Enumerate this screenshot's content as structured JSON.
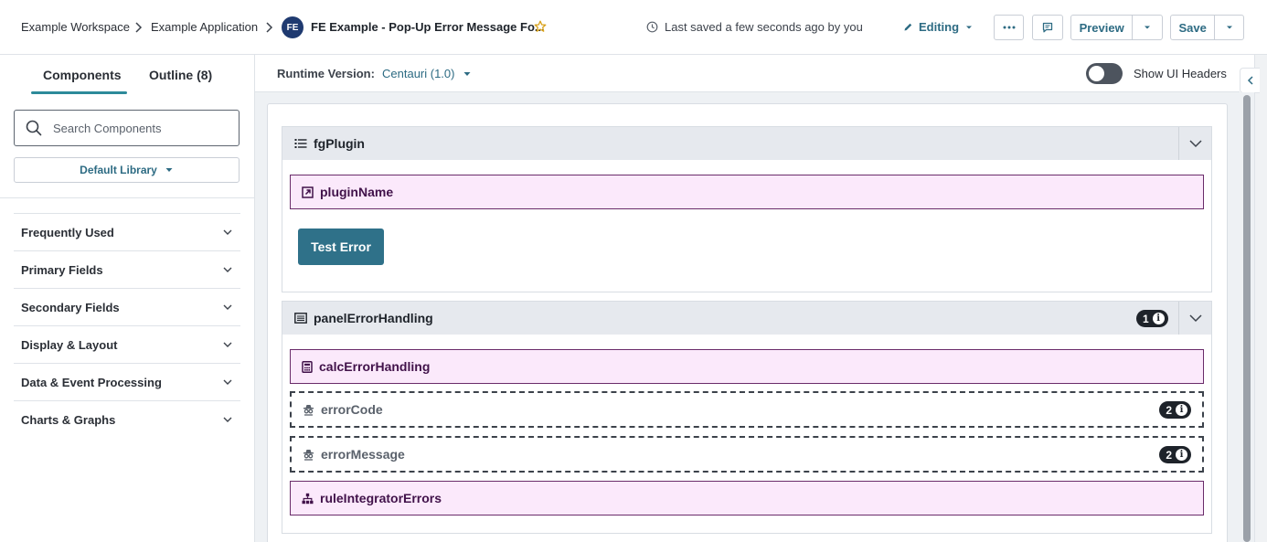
{
  "breadcrumb": {
    "workspace": "Example Workspace",
    "application": "Example Application",
    "app_badge": "FE",
    "app_title": "FE Example - Pop-Up Error Message Fo..."
  },
  "header": {
    "saved_status": "Last saved a few seconds ago by you",
    "mode_label": "Editing",
    "more_label": "···",
    "preview_label": "Preview",
    "save_label": "Save"
  },
  "sidebar": {
    "tabs": [
      {
        "label": "Components",
        "active": true
      },
      {
        "label": "Outline (8)",
        "active": false
      }
    ],
    "search_placeholder": "Search Components",
    "search_value": "",
    "library_label": "Default Library",
    "categories": [
      {
        "label": "Frequently Used"
      },
      {
        "label": "Primary Fields"
      },
      {
        "label": "Secondary Fields"
      },
      {
        "label": "Display & Layout"
      },
      {
        "label": "Data & Event Processing"
      },
      {
        "label": "Charts & Graphs"
      }
    ]
  },
  "runtime": {
    "label": "Runtime Version:",
    "value": "Centauri (1.0)",
    "toggle_label": "Show UI Headers",
    "toggle_on": false
  },
  "canvas": {
    "group1": {
      "title": "fgPlugin",
      "field": "pluginName",
      "button": "Test Error"
    },
    "group2": {
      "title": "panelErrorHandling",
      "badge_count": "1",
      "fields": [
        {
          "label": "calcErrorHandling",
          "badge": ""
        },
        {
          "label": "errorCode",
          "badge": "2"
        },
        {
          "label": "errorMessage",
          "badge": "2"
        },
        {
          "label": "ruleIntegratorErrors",
          "badge": ""
        }
      ]
    }
  },
  "colors": {
    "accent": "#2d6b83",
    "button": "#2f7189",
    "field_bg": "#fbe9fb",
    "field_border": "#6a2b6a",
    "tab_underline": "#2d8a9a"
  }
}
